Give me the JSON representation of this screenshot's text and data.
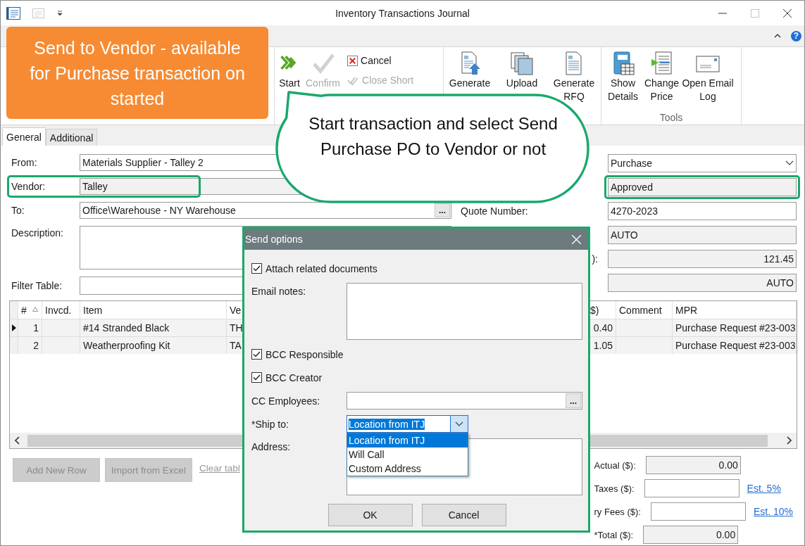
{
  "window": {
    "title": "Inventory Transactions Journal"
  },
  "help": "?",
  "callout": {
    "text": "Send to Vendor - available for Purchase transaction on started"
  },
  "bubble": {
    "text": "Start transaction and select Send Purchase PO to Vendor or not"
  },
  "ribbon": [
    {
      "large": [
        {
          "label": "Start",
          "kind": "start",
          "disabled": false
        },
        {
          "label": "Confirm",
          "kind": "confirm",
          "disabled": true
        }
      ],
      "small": [
        {
          "label": "Cancel",
          "kind": "cancel",
          "disabled": false
        },
        {
          "label": "Close Short",
          "kind": "closeshort",
          "disabled": true
        }
      ]
    },
    {
      "large": [
        {
          "label": "Generate",
          "kind": "generate",
          "disabled": false
        },
        {
          "label": "Upload",
          "kind": "upload",
          "disabled": false
        },
        {
          "label": "Generate RFQ",
          "kind": "rfq",
          "disabled": false
        }
      ]
    },
    {
      "label": "Tools",
      "large": [
        {
          "label": "Show Details",
          "kind": "details",
          "disabled": false
        },
        {
          "label": "Change Price",
          "kind": "price",
          "disabled": false
        },
        {
          "label": "Open Email Log",
          "kind": "email",
          "disabled": false
        }
      ]
    }
  ],
  "form_tabs": [
    {
      "label": "General",
      "selected": true
    },
    {
      "label": "Additional",
      "selected": false
    }
  ],
  "left_fields": [
    {
      "label": "From:",
      "value": "Materials Supplier - Talley 2",
      "kind": "text",
      "highlighted": false
    },
    {
      "label": "Vendor:",
      "value": "Talley",
      "kind": "readonly",
      "highlighted": true
    },
    {
      "label": "To:",
      "value": "Office\\Warehouse - NY Warehouse",
      "kind": "lookup",
      "button": "...",
      "highlighted": false
    },
    {
      "label": "Description:",
      "kind": "memo",
      "highlighted": false
    },
    {
      "label": "Filter Table:",
      "kind": "text",
      "highlighted": false
    }
  ],
  "right_fields": [
    {
      "value": "Purchase",
      "kind": "select",
      "highlighted": false
    },
    {
      "value": "Approved",
      "kind": "readonly",
      "highlighted": true
    },
    {
      "label": "Quote Number:",
      "value": "4270-2023",
      "kind": "text",
      "highlighted": false
    },
    {
      "value": "AUTO",
      "kind": "readonly",
      "highlighted": false
    },
    {
      "label": "):",
      "label_cut": true,
      "value": "121.45",
      "kind": "amount",
      "highlighted": false
    },
    {
      "value": "AUTO",
      "kind": "amount",
      "highlighted": false
    }
  ],
  "table": {
    "columns": [
      {
        "label": "#",
        "sorted": true
      },
      {
        "label": "Invcd.",
        "sorted": false
      },
      {
        "label": "Item",
        "sorted": false
      },
      {
        "label": "Ve",
        "sorted": false
      },
      {
        "label": "$)",
        "sorted": false
      },
      {
        "label": "Comment",
        "sorted": false
      },
      {
        "label": "MPR",
        "sorted": false
      }
    ],
    "rows": [
      {
        "selected": true,
        "cells": [
          "1",
          null,
          "#14 Stranded Black",
          "TH",
          "0.40",
          null,
          "Purchase Request #23-003"
        ]
      },
      {
        "selected": false,
        "cells": [
          "2",
          null,
          "Weatherproofing Kit",
          "TA",
          "1.05",
          null,
          "Purchase Request #23-003"
        ]
      }
    ]
  },
  "buttons": [
    {
      "label": "Add New Row",
      "disabled": true
    },
    {
      "label": "Import from Excel",
      "disabled": true
    }
  ],
  "clear_link": "Clear tabl",
  "totals": [
    {
      "label": "Actual ($):",
      "value": "0.00",
      "kind": "readonly"
    },
    {
      "label": "Taxes ($):",
      "kind": "text",
      "link": "Est. 5%"
    },
    {
      "label": "ry Fees ($):",
      "kind": "text",
      "link": "Est. 10%"
    },
    {
      "label": "*Total ($):",
      "value": "0.00",
      "kind": "readonly"
    }
  ],
  "dialog": {
    "title": "Send options",
    "rows": [
      {
        "kind": "checkbox",
        "label": "Attach related documents",
        "checked": true
      },
      {
        "kind": "memo",
        "label": "Email notes:"
      },
      {
        "kind": "checkbox",
        "label": "BCC Responsible",
        "checked": true
      },
      {
        "kind": "checkbox",
        "label": "BCC Creator",
        "checked": true
      },
      {
        "kind": "lookup",
        "label": "CC Employees:",
        "button": "..."
      },
      {
        "kind": "select",
        "label": "*Ship to:",
        "value": "Location from ITJ",
        "expanded": true,
        "options": [
          {
            "label": "Location from ITJ",
            "selected": true
          },
          {
            "label": "Will Call",
            "selected": false
          },
          {
            "label": "Custom Address",
            "selected": false
          }
        ]
      },
      {
        "kind": "memo",
        "label": "Address:"
      }
    ],
    "buttons": [
      "OK",
      "Cancel"
    ]
  }
}
